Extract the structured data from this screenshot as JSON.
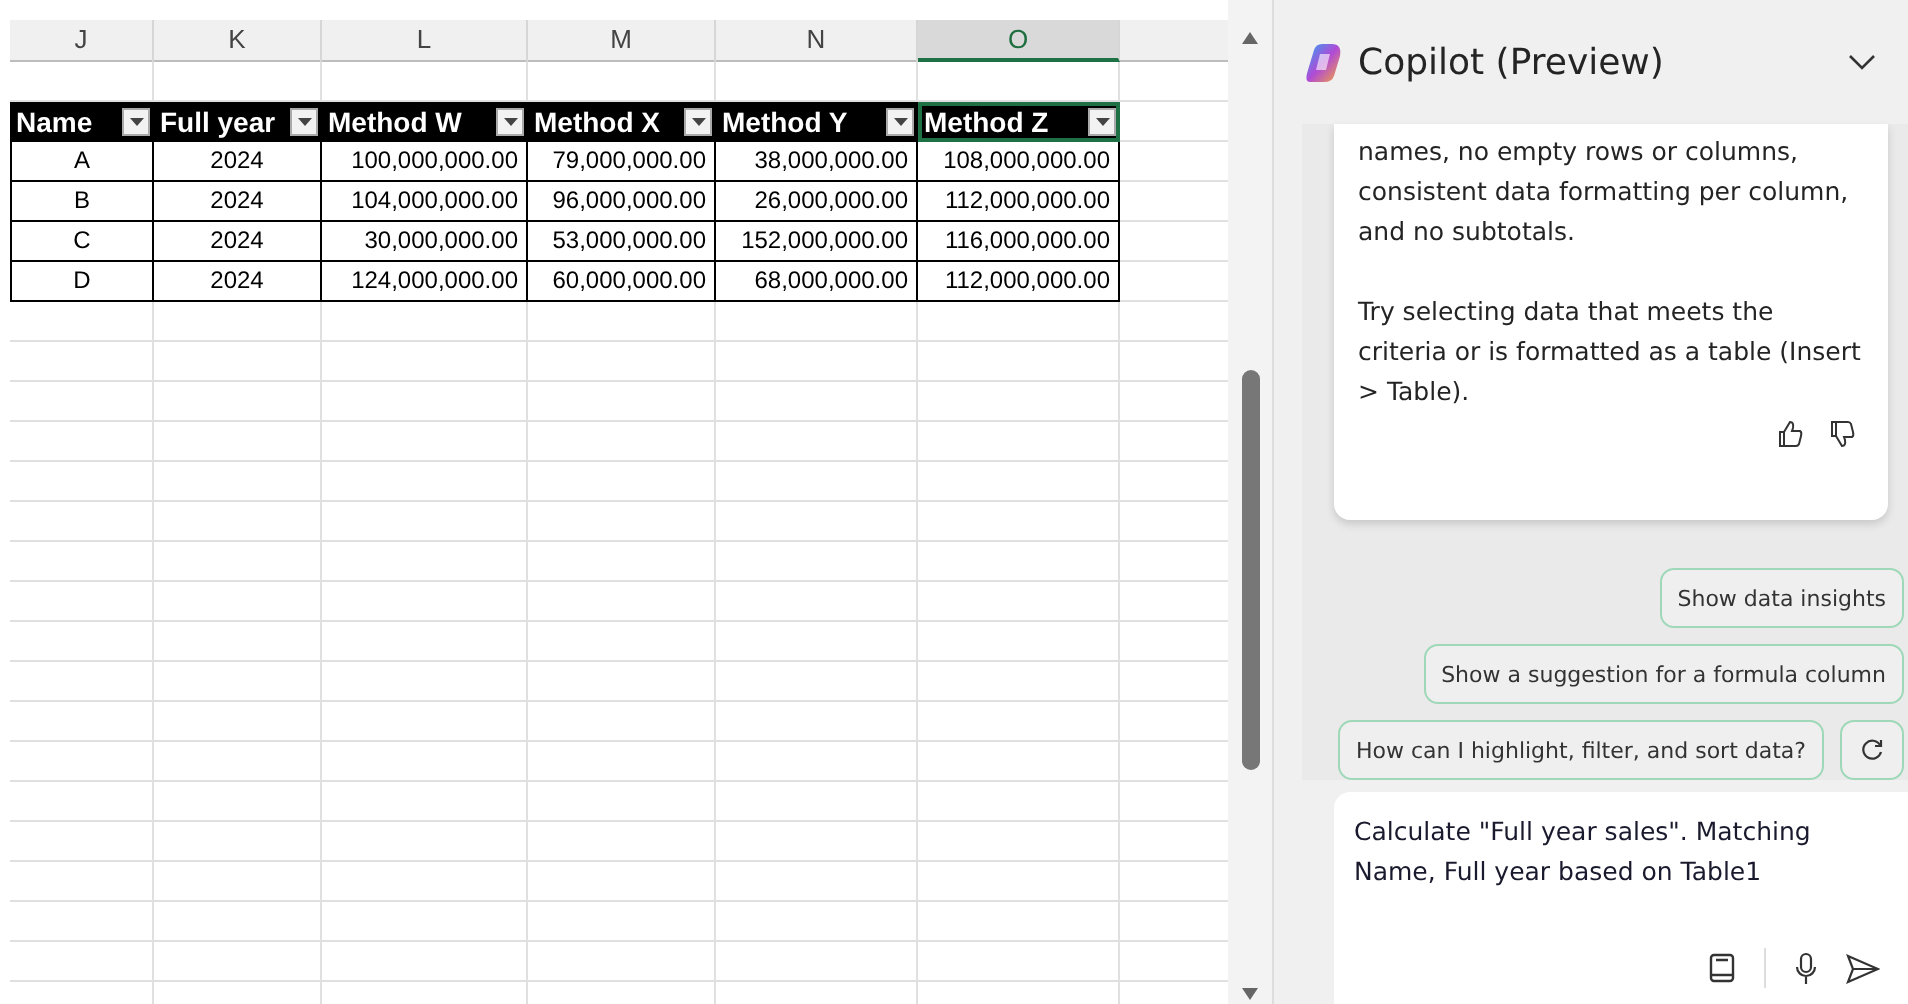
{
  "sheet": {
    "columns": [
      {
        "label": "J",
        "selected": false
      },
      {
        "label": "K",
        "selected": false
      },
      {
        "label": "L",
        "selected": false
      },
      {
        "label": "M",
        "selected": false
      },
      {
        "label": "N",
        "selected": false
      },
      {
        "label": "O",
        "selected": true
      }
    ],
    "table": {
      "headers": [
        {
          "label": "Name",
          "selected": false
        },
        {
          "label": "Full year",
          "selected": false
        },
        {
          "label": "Method W",
          "selected": false
        },
        {
          "label": "Method X",
          "selected": false
        },
        {
          "label": "Method Y",
          "selected": false
        },
        {
          "label": "Method Z",
          "selected": true
        }
      ],
      "rows": [
        [
          "A",
          "2024",
          "100,000,000.00",
          "79,000,000.00",
          "38,000,000.00",
          "108,000,000.00"
        ],
        [
          "B",
          "2024",
          "104,000,000.00",
          "96,000,000.00",
          "26,000,000.00",
          "112,000,000.00"
        ],
        [
          "C",
          "2024",
          "30,000,000.00",
          "53,000,000.00",
          "152,000,000.00",
          "116,000,000.00"
        ],
        [
          "D",
          "2024",
          "124,000,000.00",
          "60,000,000.00",
          "68,000,000.00",
          "112,000,000.00"
        ]
      ]
    }
  },
  "copilot": {
    "title": "Copilot (Preview)",
    "message": {
      "paragraphs": [
        "names, no empty rows or columns, consistent data formatting per column, and no subtotals.",
        "Try selecting data that meets the criteria or is formatted as a table (Insert > Table)."
      ]
    },
    "suggestions": [
      "Show data insights",
      "Show a suggestion for a formula column",
      "How can I highlight, filter, and sort data?"
    ],
    "input": {
      "value": "Calculate \"Full year sales\".  Matching Name, Full year based on Table1"
    }
  }
}
